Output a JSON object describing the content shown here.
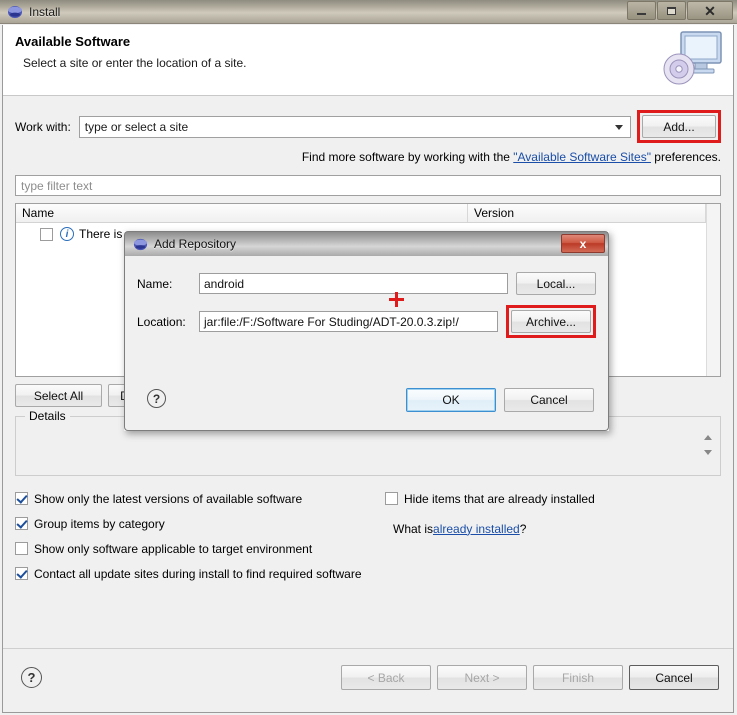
{
  "window": {
    "title": "Install",
    "icon": "eclipse-globe-icon",
    "buttons": {
      "minimize": "minimize-icon",
      "maximize": "maximize-icon",
      "close": "✕"
    }
  },
  "wizard": {
    "header": {
      "title": "Available Software",
      "subtitle": "Select a site or enter the location of a site.",
      "icon": "monitor-cd-icon"
    },
    "work_with": {
      "label": "Work with:",
      "value": "type or select a site",
      "placeholder": "type or select a site",
      "add_button": "Add...",
      "add_highlighted": true
    },
    "find_more": {
      "prefix": "Find more software by working with the ",
      "link": "\"Available Software Sites\"",
      "suffix": " preferences."
    },
    "filter": {
      "placeholder": "type filter text",
      "value": ""
    },
    "table": {
      "columns": [
        "Name",
        "Version"
      ],
      "rows": [
        {
          "checked": false,
          "icon": "info-icon",
          "name": "There is",
          "version": ""
        }
      ]
    },
    "selection_buttons": [
      "Select All",
      "Deselect All"
    ],
    "details": {
      "legend": "Details",
      "text": ""
    },
    "options": {
      "left": [
        {
          "label": "Show only the latest versions of available software",
          "checked": true
        },
        {
          "label": "Group items by category",
          "checked": true
        },
        {
          "label": "Show only software applicable to target environment",
          "checked": false
        },
        {
          "label": "Contact all update sites during install to find required software",
          "checked": true
        }
      ],
      "right": [
        {
          "label": "Hide items that are already installed",
          "checked": false
        }
      ],
      "what_is": {
        "prefix": "What is ",
        "link": "already installed",
        "suffix": "?"
      }
    },
    "footer": {
      "help": "?",
      "buttons": [
        {
          "label": "< Back",
          "enabled": false
        },
        {
          "label": "Next >",
          "enabled": false
        },
        {
          "label": "Finish",
          "enabled": false
        },
        {
          "label": "Cancel",
          "enabled": true,
          "default": true
        }
      ]
    }
  },
  "modal": {
    "title": "Add Repository",
    "icon": "eclipse-globe-icon",
    "close_label": "x",
    "fields": [
      {
        "label": "Name:",
        "value": "android",
        "button": "Local...",
        "highlighted": false
      },
      {
        "label": "Location:",
        "value": "jar:file:/F:/Software For Studing/ADT-20.0.3.zip!/",
        "button": "Archive...",
        "highlighted": true
      }
    ],
    "help": "?",
    "buttons": [
      {
        "label": "OK",
        "focused": true
      },
      {
        "label": "Cancel",
        "focused": false
      }
    ]
  },
  "colors": {
    "highlight": "#e01b1b",
    "link": "#1a4ea8",
    "window_bg": "#f0f0f0"
  }
}
